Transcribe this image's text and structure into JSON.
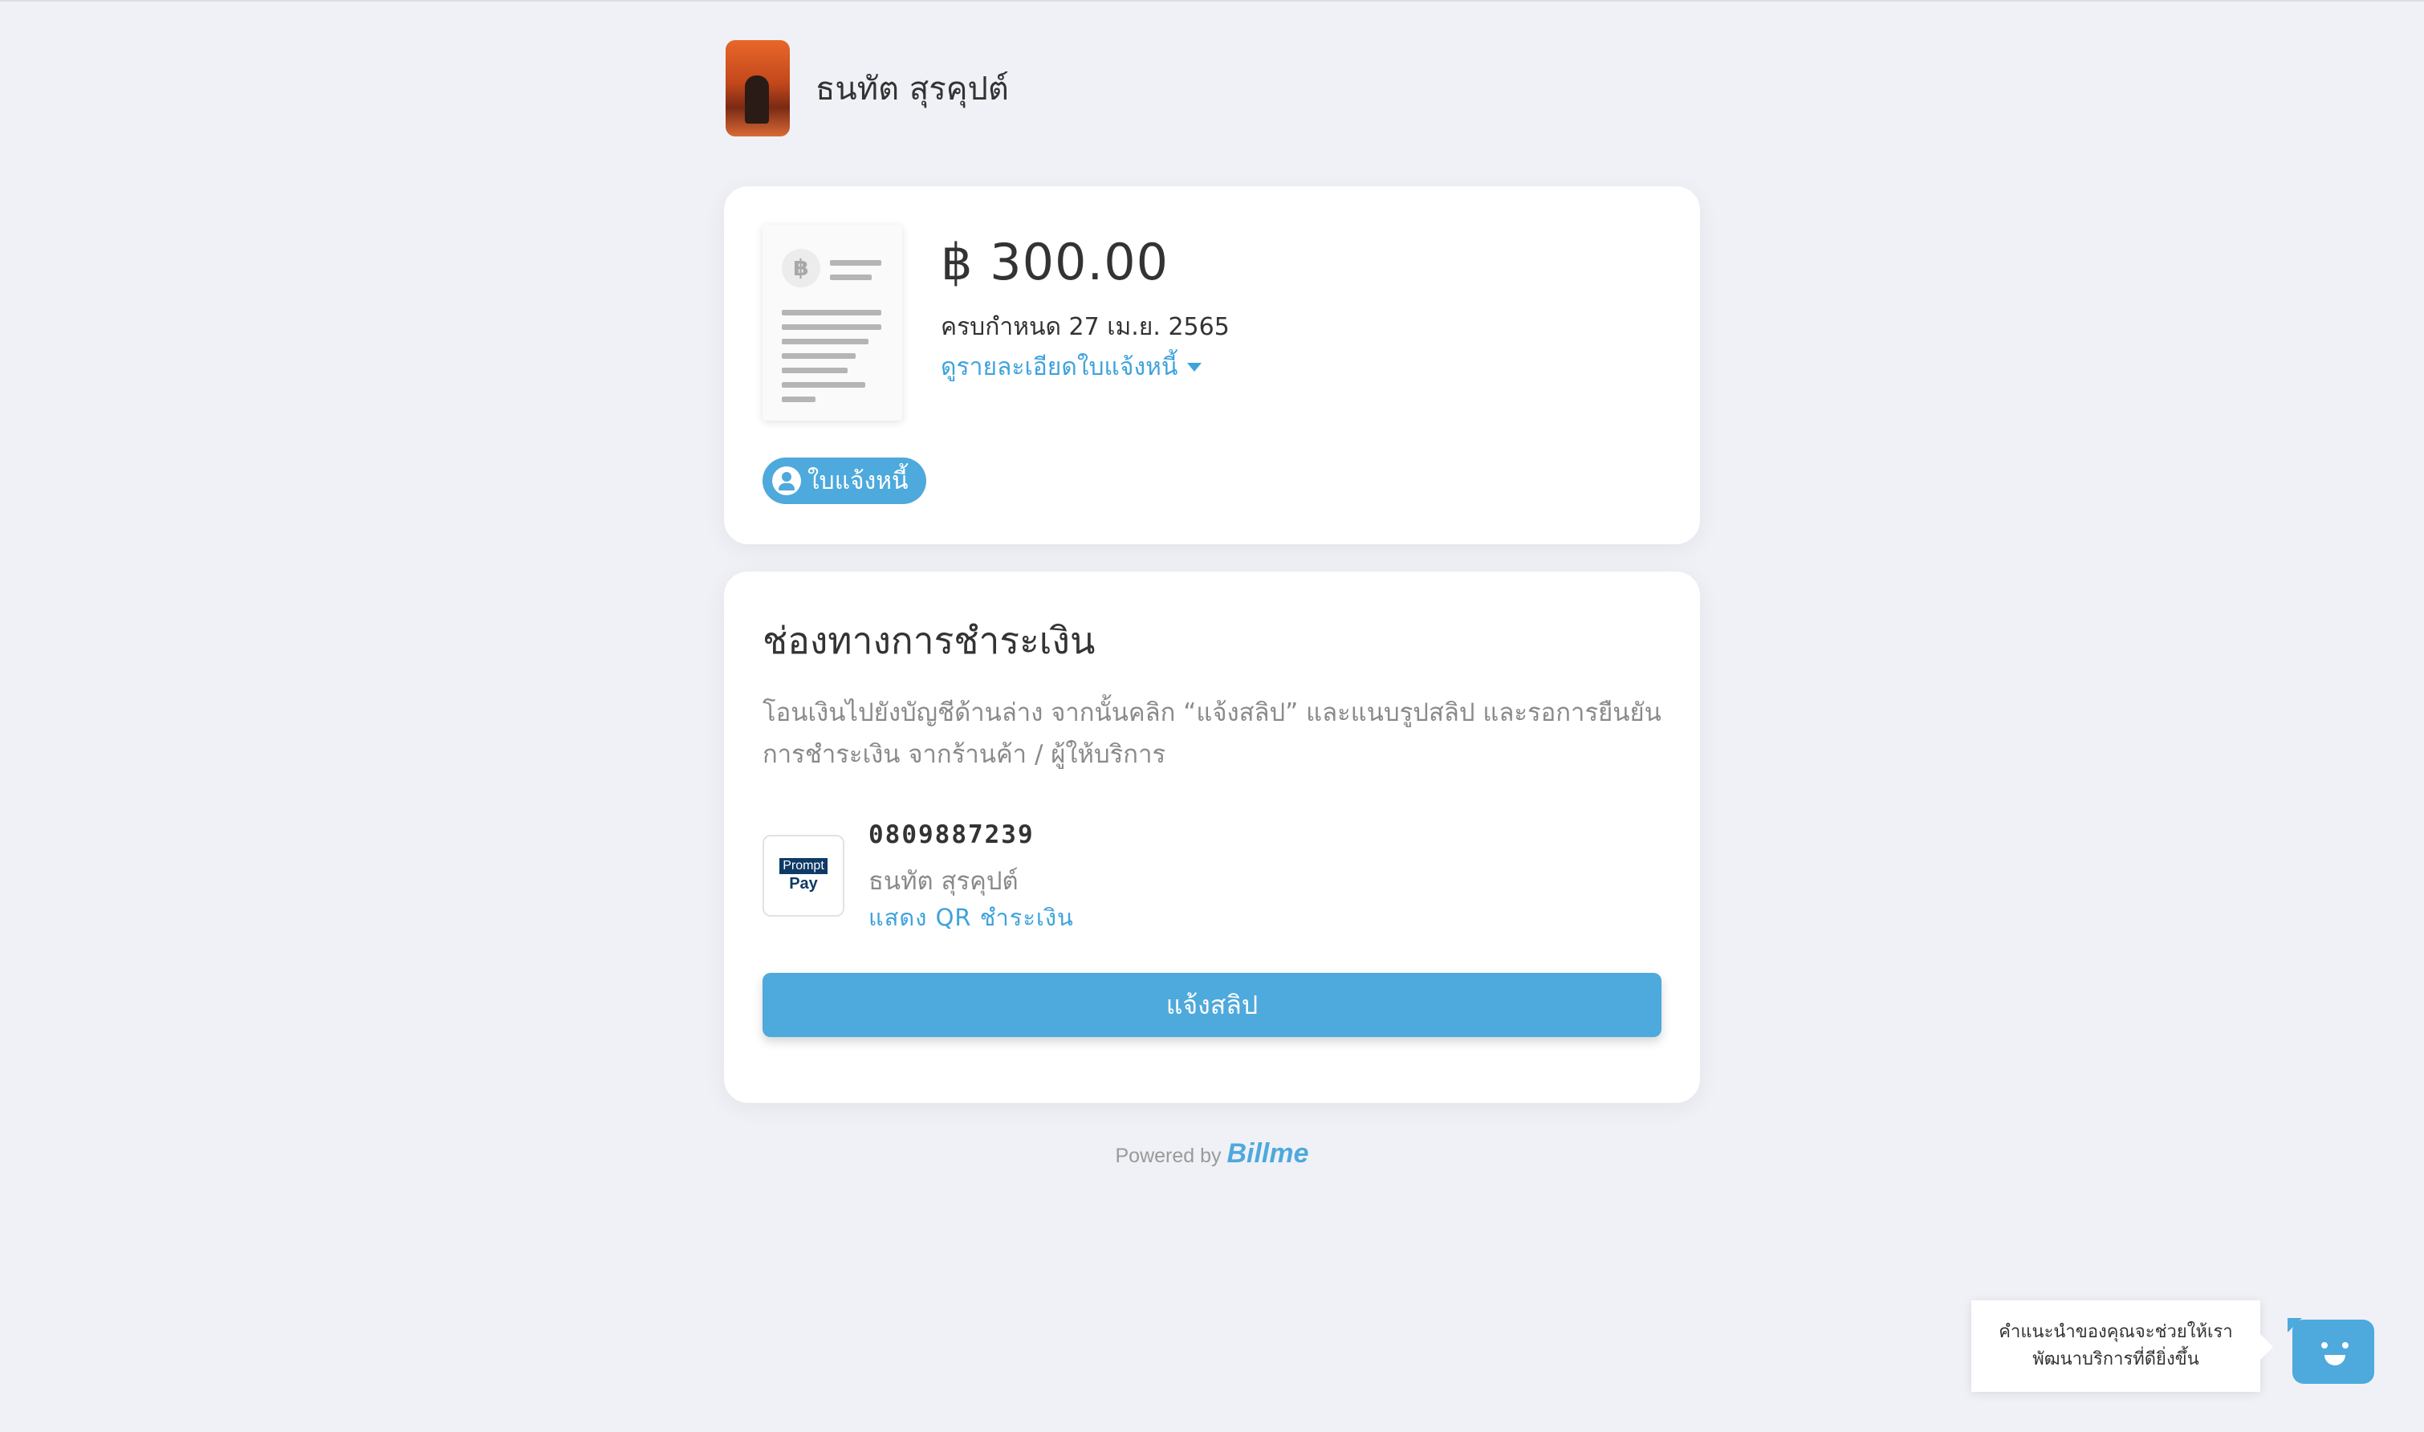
{
  "merchant": {
    "name": "ธนทัต สุรคุปต์"
  },
  "invoice": {
    "amount": "฿ 300.00",
    "due": "ครบกำหนด 27 เม.ย. 2565",
    "detail_link": "ดูรายละเอียดใบแจ้งหนี้",
    "badge": "ใบแจ้งหนี้",
    "thumb_currency_symbol": "฿"
  },
  "payment": {
    "title": "ช่องทางการชำระเงิน",
    "description": "โอนเงินไปยังบัญชีด้านล่าง จากนั้นคลิก “แจ้งสลิป” และแนบรูปสลิป และรอการยืนยันการชำระเงิน จากร้านค้า / ผู้ให้บริการ",
    "method": {
      "logo_top": "Prompt",
      "logo_bottom": "Pay",
      "number": "0809887239",
      "name": "ธนทัต สุรคุปต์",
      "qr_link": "แสดง QR ชำระเงิน"
    },
    "slip_button": "แจ้งสลิป"
  },
  "footer": {
    "powered_by": "Powered by",
    "brand": "Billme"
  },
  "feedback": {
    "line1": "คำแนะนำของคุณจะช่วยให้เรา",
    "line2": "พัฒนาบริการที่ดียิ่งขึ้น"
  },
  "colors": {
    "accent": "#4ea9dc",
    "background": "#f0f1f6"
  }
}
